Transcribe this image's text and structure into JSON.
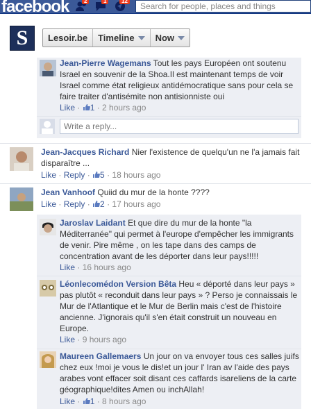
{
  "topbar": {
    "logo": "facebook",
    "badges": {
      "friends": "2",
      "messages": "1",
      "notifications": "12"
    },
    "search_placeholder": "Search for people, places and things"
  },
  "page": {
    "logo_letter": "S",
    "buttons": {
      "page_name": "Lesoir.be",
      "timeline": "Timeline",
      "now": "Now"
    }
  },
  "comments": [
    {
      "author": "Jean-Pierre Wagemans",
      "text": "Tout les pays Européen ont soutenu Israel en souvenir de la Shoa.Il est maintenant temps de voir Israel comme état religieux antidémocratique sans pour cela se faire traiter d'antisémite non antisionniste oui",
      "like": "Like",
      "likes_count": "1",
      "time": "2 hours ago"
    },
    {
      "author": "Jean-Jacques Richard",
      "text": "Nier l'existence de quelqu'un ne l'a jamais fait disparaître ...",
      "like": "Like",
      "reply": "Reply",
      "likes_count": "5",
      "time": "18 hours ago"
    },
    {
      "author": "Jean Vanhoof",
      "text": "Quiid du mur de la honte ????",
      "like": "Like",
      "reply": "Reply",
      "likes_count": "2",
      "time": "17 hours ago"
    },
    {
      "author": "Jaroslav Laidant",
      "text": "Et que dire du mur de la honte \"la Méditerranée\" qui permet à l'europe d'empêcher les immigrants de venir. Pire même , on les tape dans des camps de concentration avant de les déporter dans leur pays!!!!!",
      "like": "Like",
      "time": "16 hours ago"
    },
    {
      "author": "Léonlecomédon Version Bêta",
      "text": "Heu « déporté dans leur pays » pas plutôt « reconduit dans leur pays » ? Perso je connaissais le Mur de l'Atlantique et le Mur de Berlin mais c'est de l'histoire ancienne. J'ignorais qu'il s'en était construit un nouveau en Europe.",
      "like": "Like",
      "time": "9 hours ago"
    },
    {
      "author": "Maureen Gallemaers",
      "text": "Un jour on va envoyer tous ces salles juifs chez eux !moi je vous le dis!et un jour l' Iran av l'aide des pays arabes vont effacer soit disant ces caffards isareliens de la carte géographique!dites Amen ou inchAllah!",
      "like": "Like",
      "likes_count": "1",
      "time": "8 hours ago"
    }
  ],
  "reply_placeholder": "Write a reply...",
  "colors": {
    "facebook_blue": "#3b5998",
    "reply_bg": "#edeff4",
    "badge_red": "#f03d25"
  },
  "icons": [
    "friends-icon",
    "messages-icon",
    "notifications-icon",
    "like-thumb-icon"
  ]
}
